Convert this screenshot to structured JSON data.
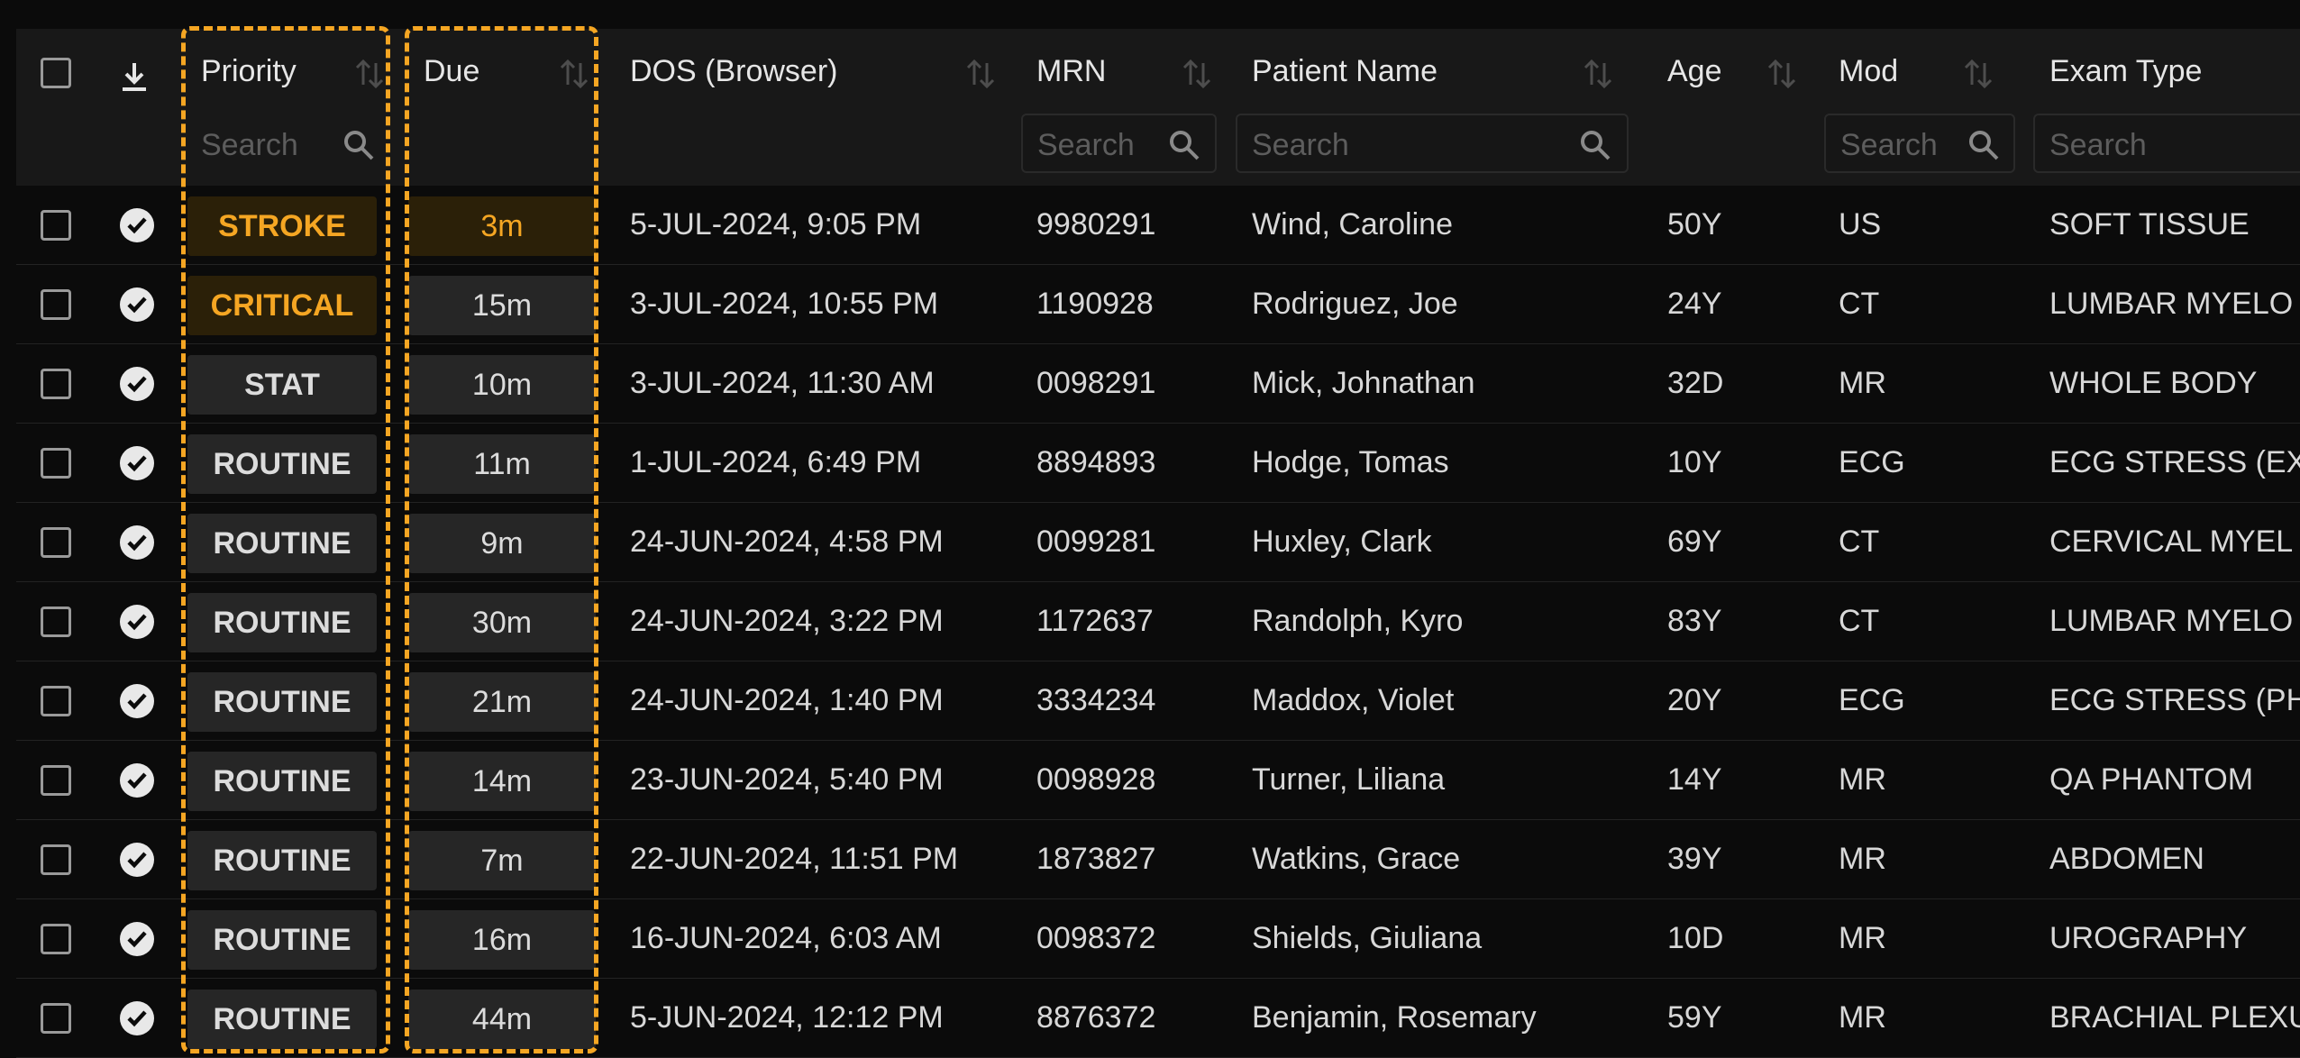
{
  "colors": {
    "accent": "#f5a623",
    "stroke_bg": "#2b2008",
    "critical_bg": "#2b2008",
    "default_bg": "#262626"
  },
  "header": {
    "download_icon": "download-icon",
    "columns": {
      "priority": "Priority",
      "due": "Due",
      "dos": "DOS (Browser)",
      "mrn": "MRN",
      "patient": "Patient Name",
      "age": "Age",
      "mod": "Mod",
      "exam": "Exam Type"
    },
    "search_placeholder": "Search"
  },
  "rows": [
    {
      "priority": "STROKE",
      "due": "3m",
      "dos": "5-JUL-2024, 9:05 PM",
      "mrn": "9980291",
      "patient": "Wind, Caroline",
      "age": "50Y",
      "mod": "US",
      "exam": "SOFT TISSUE"
    },
    {
      "priority": "CRITICAL",
      "due": "15m",
      "dos": "3-JUL-2024, 10:55 PM",
      "mrn": "1190928",
      "patient": "Rodriguez, Joe",
      "age": "24Y",
      "mod": "CT",
      "exam": "LUMBAR MYELO"
    },
    {
      "priority": "STAT",
      "due": "10m",
      "dos": "3-JUL-2024, 11:30 AM",
      "mrn": "0098291",
      "patient": "Mick, Johnathan",
      "age": "32D",
      "mod": "MR",
      "exam": "WHOLE BODY"
    },
    {
      "priority": "ROUTINE",
      "due": "11m",
      "dos": "1-JUL-2024, 6:49 PM",
      "mrn": "8894893",
      "patient": "Hodge, Tomas",
      "age": "10Y",
      "mod": "ECG",
      "exam": "ECG STRESS (EX"
    },
    {
      "priority": "ROUTINE",
      "due": "9m",
      "dos": "24-JUN-2024, 4:58 PM",
      "mrn": "0099281",
      "patient": "Huxley, Clark",
      "age": "69Y",
      "mod": "CT",
      "exam": "CERVICAL MYEL"
    },
    {
      "priority": "ROUTINE",
      "due": "30m",
      "dos": "24-JUN-2024, 3:22 PM",
      "mrn": "1172637",
      "patient": "Randolph, Kyro",
      "age": "83Y",
      "mod": "CT",
      "exam": "LUMBAR MYELO"
    },
    {
      "priority": "ROUTINE",
      "due": "21m",
      "dos": "24-JUN-2024, 1:40 PM",
      "mrn": "3334234",
      "patient": "Maddox, Violet",
      "age": "20Y",
      "mod": "ECG",
      "exam": "ECG STRESS (PH"
    },
    {
      "priority": "ROUTINE",
      "due": "14m",
      "dos": "23-JUN-2024, 5:40 PM",
      "mrn": "0098928",
      "patient": "Turner, Liliana",
      "age": "14Y",
      "mod": "MR",
      "exam": "QA PHANTOM"
    },
    {
      "priority": "ROUTINE",
      "due": "7m",
      "dos": "22-JUN-2024, 11:51 PM",
      "mrn": "1873827",
      "patient": "Watkins, Grace",
      "age": "39Y",
      "mod": "MR",
      "exam": "ABDOMEN"
    },
    {
      "priority": "ROUTINE",
      "due": "16m",
      "dos": "16-JUN-2024, 6:03 AM",
      "mrn": "0098372",
      "patient": "Shields, Giuliana",
      "age": "10D",
      "mod": "MR",
      "exam": "UROGRAPHY"
    },
    {
      "priority": "ROUTINE",
      "due": "44m",
      "dos": "5-JUN-2024, 12:12 PM",
      "mrn": "8876372",
      "patient": "Benjamin, Rosemary",
      "age": "59Y",
      "mod": "MR",
      "exam": "BRACHIAL PLEXU"
    }
  ]
}
